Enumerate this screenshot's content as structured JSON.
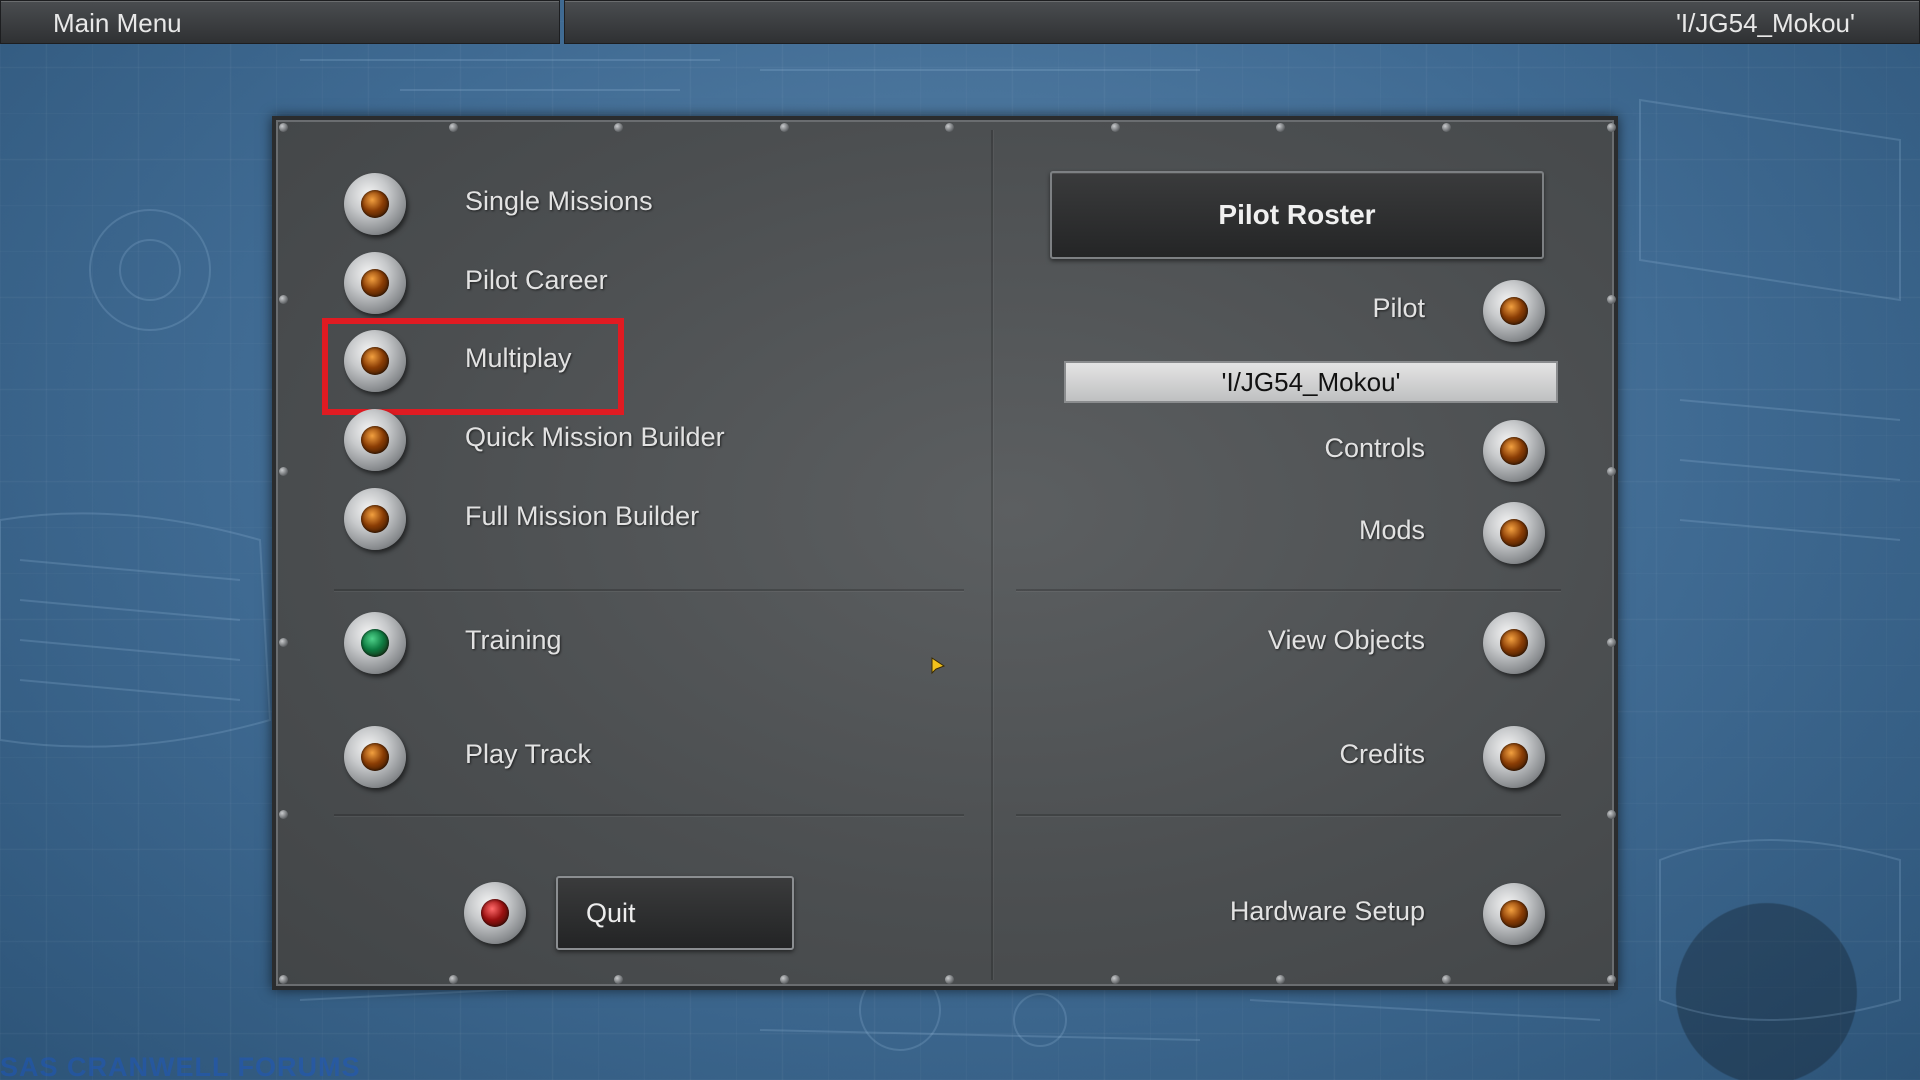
{
  "top_bar": {
    "title": "Main Menu",
    "pilot_name": "'I/JG54_Mokou'"
  },
  "left_menu": {
    "items": [
      {
        "label": "Single Missions",
        "lamp": "amber"
      },
      {
        "label": "Pilot Career",
        "lamp": "amber"
      },
      {
        "label": "Multiplay",
        "lamp": "amber",
        "highlighted": true
      },
      {
        "label": "Quick Mission Builder",
        "lamp": "amber"
      },
      {
        "label": "Full Mission Builder",
        "lamp": "amber"
      },
      {
        "label": "Training",
        "lamp": "green"
      },
      {
        "label": "Play Track",
        "lamp": "amber"
      }
    ],
    "quit_label": "Quit",
    "quit_lamp": "red"
  },
  "right_menu": {
    "roster_title": "Pilot Roster",
    "pilot_label": "Pilot",
    "pilot_value": "'I/JG54_Mokou'",
    "items": [
      {
        "label": "Controls",
        "lamp": "amber"
      },
      {
        "label": "Mods",
        "lamp": "amber"
      },
      {
        "label": "View Objects",
        "lamp": "amber"
      },
      {
        "label": "Credits",
        "lamp": "amber"
      },
      {
        "label": "Hardware Setup",
        "lamp": "amber"
      }
    ]
  },
  "watermark": "SAS CRANWELL FORUMS",
  "colors": {
    "background": "#3f6a92",
    "panel": "#4b4e50",
    "highlight": "#e01b22",
    "lamp_amber": "#8a3d05",
    "lamp_green": "#0d7a40",
    "lamp_red": "#9a1010"
  }
}
